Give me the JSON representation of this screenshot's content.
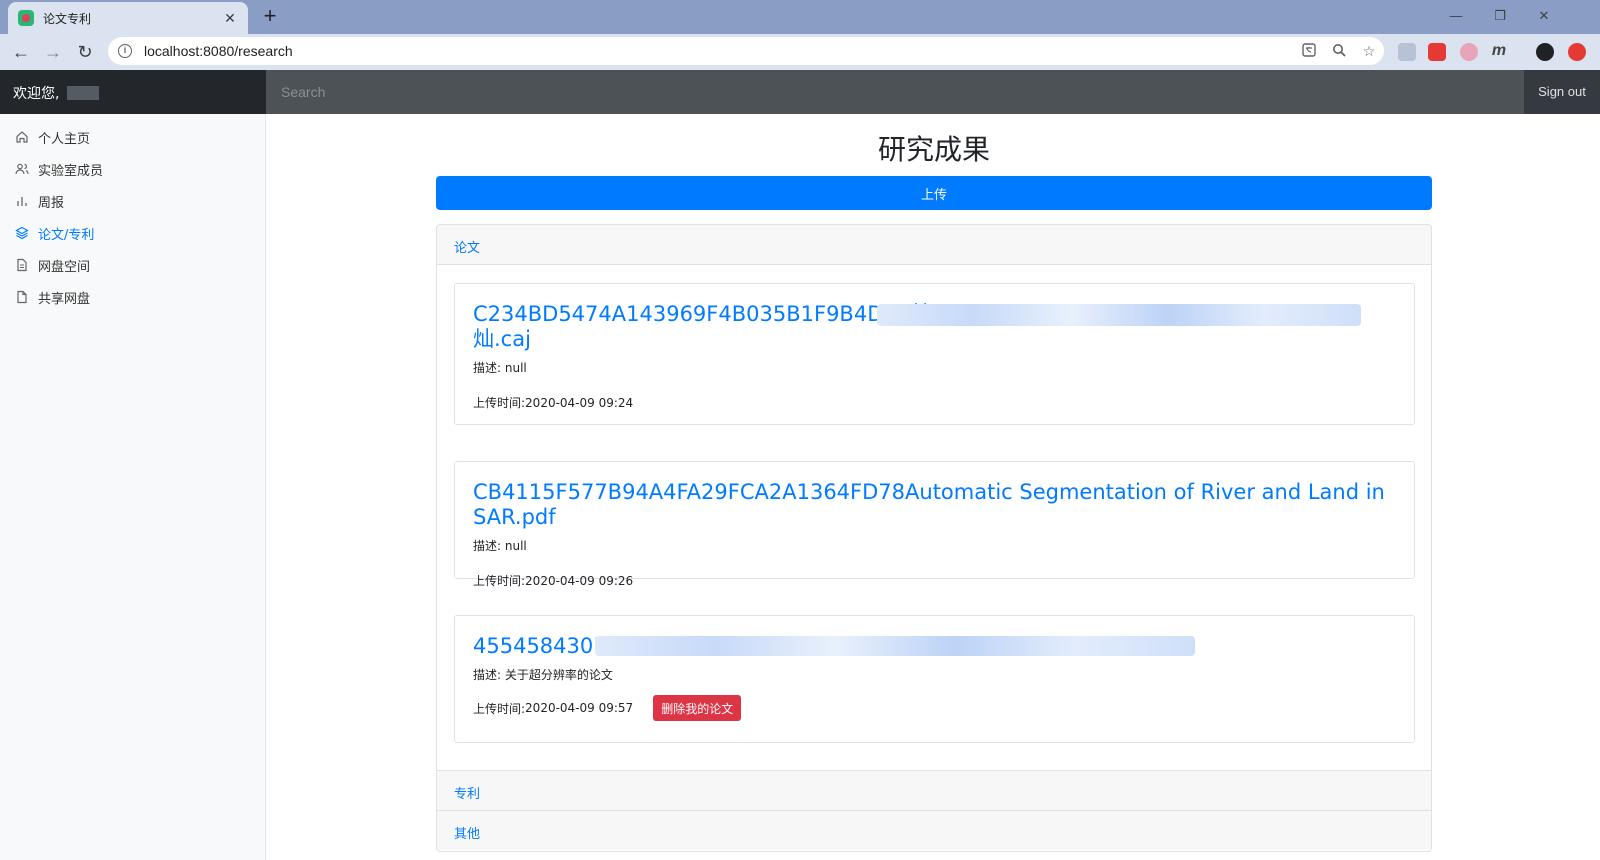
{
  "browser": {
    "tab_title": "论文专利",
    "url": "localhost:8080/research",
    "new_tab_symbol": "+",
    "tab_close_symbol": "✕"
  },
  "navbar": {
    "welcome": "欢迎您,",
    "search_placeholder": "Search",
    "sign_out": "Sign out"
  },
  "sidebar": {
    "items": [
      {
        "label": "个人主页",
        "icon": "home-icon",
        "active": false
      },
      {
        "label": "实验室成员",
        "icon": "users-icon",
        "active": false
      },
      {
        "label": "周报",
        "icon": "bar-chart-icon",
        "active": false
      },
      {
        "label": "论文/专利",
        "icon": "layers-icon",
        "active": true
      },
      {
        "label": "网盘空间",
        "icon": "file-text-icon",
        "active": false
      },
      {
        "label": "共享网盘",
        "icon": "file-icon",
        "active": false
      }
    ]
  },
  "main": {
    "title": "研究成果",
    "upload_label": "上传",
    "sections": [
      {
        "label": "论文"
      },
      {
        "label": "专利"
      },
      {
        "label": "其他"
      }
    ],
    "papers": [
      {
        "title": "C234BD5474A143969F4B035B1F9B4DE9基",
        "title_tail": "灿.caj",
        "desc_label": "描述: ",
        "desc": "null",
        "time_label": "上传时间: ",
        "time": "2020-04-09 09:24"
      },
      {
        "title": "CB4115F577B94A4FA29FCA2A1364FD78Automatic Segmentation of River and Land in SAR.pdf",
        "desc_label": "描述: ",
        "desc": "null",
        "time_label": "上传时间: ",
        "time": "2020-04-09 09:26"
      },
      {
        "title": "455458430F",
        "desc_label": "描述: ",
        "desc": "关于超分辨率的论文",
        "time_label": "上传时间: ",
        "time": "2020-04-09 09:57",
        "delete_label": "删除我的论文"
      }
    ]
  },
  "colors": {
    "primary": "#007bff",
    "danger": "#dc3545",
    "navbar": "#343a40"
  }
}
